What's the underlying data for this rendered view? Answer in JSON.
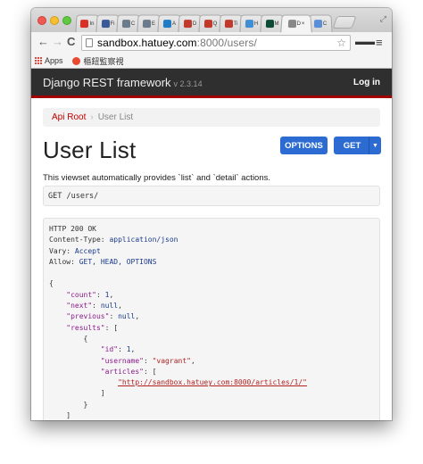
{
  "browser": {
    "tabs": [
      {
        "label": "In",
        "icon": "gmail-icon",
        "color": "#d93025"
      },
      {
        "label": "Fi",
        "icon": "facebook-icon",
        "color": "#3b5998"
      },
      {
        "label": "C",
        "icon": "image-icon",
        "color": "#6b7b8c"
      },
      {
        "label": "E",
        "icon": "image-icon",
        "color": "#6b7b8c"
      },
      {
        "label": "A",
        "icon": "trello-icon",
        "color": "#1e7bc4"
      },
      {
        "label": "D",
        "icon": "pin-icon",
        "color": "#c0392b"
      },
      {
        "label": "Q",
        "icon": "pin-icon",
        "color": "#c0392b"
      },
      {
        "label": "Ti",
        "icon": "pin-icon",
        "color": "#c0392b"
      },
      {
        "label": "H",
        "icon": "grid-icon",
        "color": "#3f8fd2"
      },
      {
        "label": "M",
        "icon": "django-icon",
        "color": "#0c4b33"
      },
      {
        "label": "D",
        "icon": "page-icon",
        "color": "#888888",
        "active": true
      },
      {
        "label": "C",
        "icon": "drive-icon",
        "color": "#5a8fd8"
      }
    ],
    "url_host": "sandbox.hatuey.com",
    "url_rest": ":8000/users/",
    "bookmarks": {
      "apps_label": "Apps",
      "item_label": "樞鈕監察視"
    }
  },
  "navbar": {
    "brand": "Django REST framework",
    "version": "v 2.3.14",
    "login": "Log in"
  },
  "breadcrumb": {
    "root": "Api Root",
    "separator": "›",
    "current": "User List"
  },
  "header": {
    "title": "User List",
    "options_label": "OPTIONS",
    "get_label": "GET"
  },
  "description": "This viewset automatically provides `list` and `detail` actions.",
  "request": "GET /users/",
  "response": {
    "status": "HTTP 200 OK",
    "headers": [
      {
        "key": "Content-Type",
        "value": "application/json"
      },
      {
        "key": "Vary",
        "value": "Accept"
      },
      {
        "key": "Allow",
        "value": "GET, HEAD, OPTIONS"
      }
    ],
    "body": {
      "open_brace": "{",
      "count_key": "\"count\"",
      "count_val": "1",
      "next_key": "\"next\"",
      "next_val": "null",
      "previous_key": "\"previous\"",
      "previous_val": "null",
      "results_key": "\"results\"",
      "open_bracket": "[",
      "item_open": "{",
      "id_key": "\"id\"",
      "id_val": "1",
      "username_key": "\"username\"",
      "username_val": "\"vagrant\"",
      "articles_key": "\"articles\"",
      "articles_open": "[",
      "article_link": "\"http://sandbox.hatuey.com:8000/articles/1/\"",
      "articles_close": "]",
      "item_close": "}",
      "close_bracket": "]",
      "close_brace": "}"
    }
  },
  "colors": {
    "navbar_bg": "#2f2f2f",
    "navbar_accent": "#a30000",
    "primary_button": "#2c6bd1",
    "link": "#c20000"
  }
}
